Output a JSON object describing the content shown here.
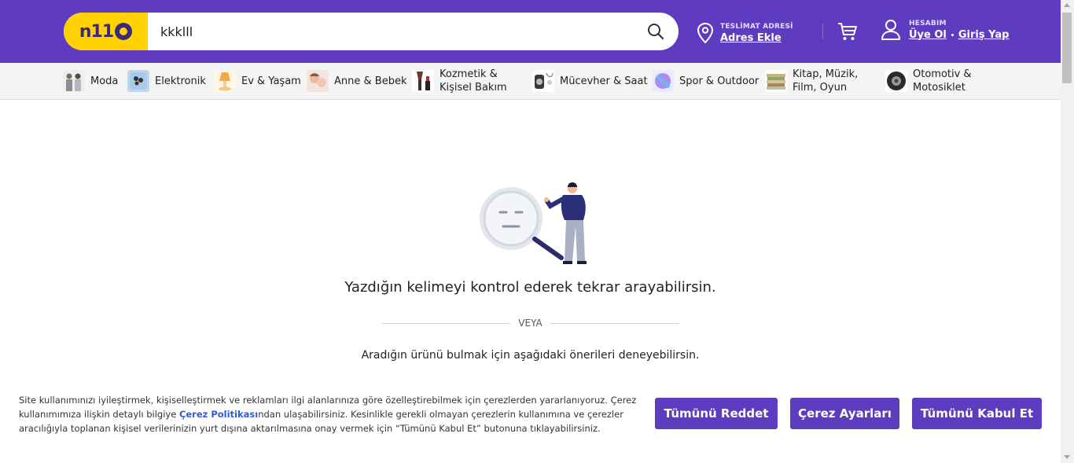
{
  "header": {
    "logo_text": "n11",
    "search": {
      "value": "kkklll",
      "placeholder": ""
    },
    "address": {
      "caption": "TESLİMAT ADRESİ",
      "link": "Adres Ekle"
    },
    "account": {
      "caption": "HESABIM",
      "register": "Üye Ol",
      "login": "Giriş Yap"
    },
    "colors": {
      "brand": "#5f3bbf",
      "logo_bg": "#ffd200"
    }
  },
  "categories": [
    {
      "label": "Moda",
      "icon": "fashion-icon"
    },
    {
      "label": "Elektronik",
      "icon": "electronics-icon"
    },
    {
      "label": "Ev & Yaşam",
      "icon": "home-icon"
    },
    {
      "label": "Anne & Bebek",
      "icon": "baby-icon"
    },
    {
      "label": "Kozmetik & Kişisel Bakım",
      "line1": "Kozmetik &",
      "line2": "Kişisel Bakım",
      "icon": "cosmetics-icon"
    },
    {
      "label": "Mücevher & Saat",
      "icon": "jewelry-icon"
    },
    {
      "label": "Spor & Outdoor",
      "icon": "sports-icon"
    },
    {
      "label": "Kitap, Müzik, Film, Oyun",
      "line1": "Kitap, Müzik,",
      "line2": "Film, Oyun",
      "icon": "books-icon"
    },
    {
      "label": "Otomotiv & Motosiklet",
      "line1": "Otomotiv &",
      "line2": "Motosiklet",
      "icon": "tire-icon"
    }
  ],
  "main": {
    "message": "Yazdığın kelimeyi kontrol ederek tekrar arayabilirsin.",
    "or_text": "VEYA",
    "suggestion": "Aradığın ürünü bulmak için aşağıdaki önerileri deneyebilirsin."
  },
  "cookie": {
    "text_before": "Site kullanımınızı iyileştirmek, kişiselleştirmek ve reklamları ilgi alanlarınıza göre özelleştirebilmek için çerezlerden yararlanıyoruz. Çerez kullanımımıza ilişkin detaylı bilgiye ",
    "policy_link": "Çerez Politikası",
    "text_after": "ndan ulaşabilirsiniz. Kesinlikle gerekli olmayan çerezlerin kullanımına ve çerezler aracılığıyla toplanan kişisel verilerinizin yurt dışına aktarılmasına onay vermek için “Tümünü Kabul Et” butonuna tıklayabilirsiniz.",
    "reject": "Tümünü Reddet",
    "settings": "Çerez Ayarları",
    "accept": "Tümünü Kabul Et"
  }
}
